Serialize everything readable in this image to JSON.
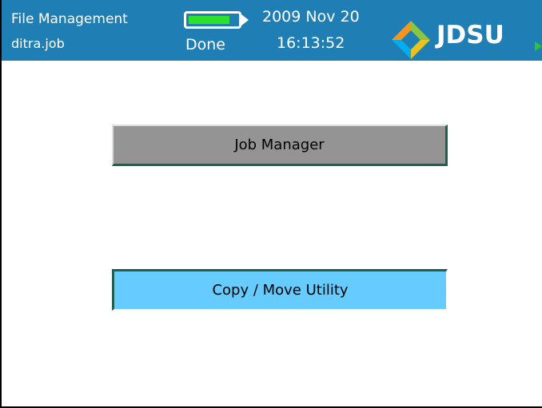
{
  "header": {
    "title": "File Management",
    "filename": "ditra.job",
    "battery_level_fraction": 0.85,
    "status": "Done",
    "date": "2009 Nov 20",
    "time": "16:13:52",
    "brand": "JDSU",
    "brand_colors": [
      "#8cc63f",
      "#f7941d",
      "#00aeef",
      "#e8c21e"
    ]
  },
  "buttons": {
    "job_manager": "Job Manager",
    "copy_move": "Copy / Move Utility"
  },
  "colors": {
    "header_bg": "#1f7fb5",
    "button_gray": "#949494",
    "button_selected": "#66ccff"
  }
}
